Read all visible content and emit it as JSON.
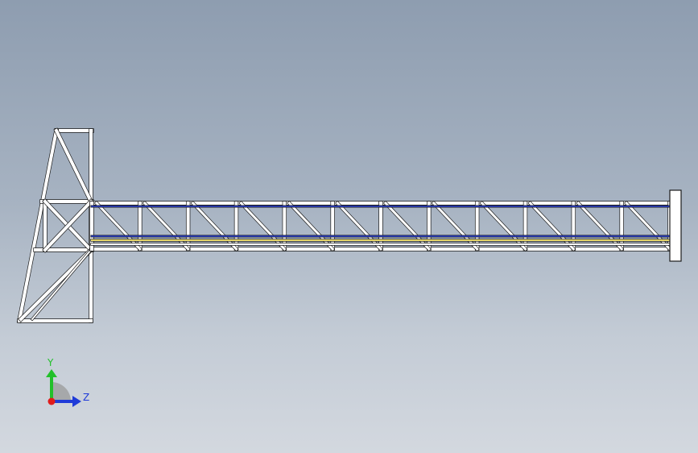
{
  "viewport": {
    "background_top": "#8e9db0",
    "background_bottom": "#d3d8df"
  },
  "model": {
    "name": "truss-boom",
    "truss_bays": 12,
    "member_color": "#ffffff",
    "outline_color": "#1a1a1a",
    "highlight_blue": "#2b3fd1",
    "highlight_yellow": "#e8d86a"
  },
  "triad": {
    "y_label": "Y",
    "z_label": "Z",
    "y_color": "#22c02a",
    "z_color": "#1f3bd8",
    "x_color": "#e01b1b",
    "y_icon": "y-axis-arrow",
    "z_icon": "z-axis-arrow",
    "x_icon": "x-axis-origin-dot"
  }
}
